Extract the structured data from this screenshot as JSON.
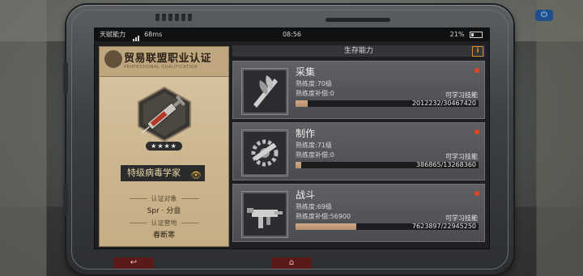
{
  "status": {
    "carrier": "天赋能力",
    "ping": "68ms",
    "time": "08:56",
    "battery": "21%"
  },
  "certificate": {
    "title": "贸易联盟职业认证",
    "subtitle": "PROFESSIONAL QUALIFICATION",
    "stars": "★★★★",
    "rank": "特级病毒学家",
    "target_label": "认证对象",
    "target_value": "Spr · 分韭",
    "camp_label": "认证营地",
    "camp_value": "春断寒"
  },
  "panel": {
    "header": "生存能力",
    "info": "i"
  },
  "skills": [
    {
      "name": "采集",
      "level": "熟练度:70级",
      "compensation": "熟练度补偿:0",
      "learnable": "可学习技能",
      "progress": "2012232/30467420",
      "fill": 0.066,
      "icon": "leaf-knife-icon"
    },
    {
      "name": "制作",
      "level": "熟练度:71级",
      "compensation": "熟练度补偿:0",
      "learnable": "可学习技能",
      "progress": "386865/13268360",
      "fill": 0.029,
      "icon": "gear-hammer-icon"
    },
    {
      "name": "战斗",
      "level": "熟练度:69级",
      "compensation": "熟练度补偿:56900",
      "learnable": "可学习技能",
      "progress": "7623897/22945250",
      "fill": 0.332,
      "icon": "submachine-gun-icon"
    }
  ],
  "nav": {
    "back": "↩",
    "home": "⌂"
  },
  "colors": {
    "accent": "#e08a2a",
    "alert_dot": "#e04520",
    "progress_fill": "#c79c77"
  }
}
